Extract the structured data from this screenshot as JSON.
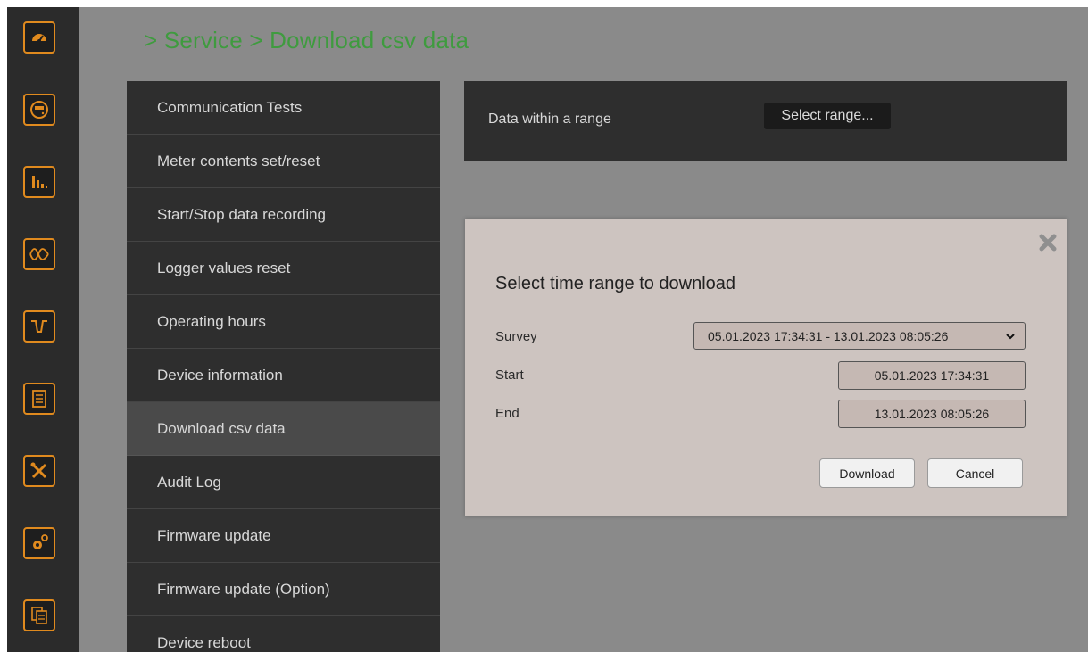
{
  "breadcrumb": "> Service > Download csv data",
  "rail_icons": [
    "gauge-icon",
    "meter-icon",
    "bar-chart-icon",
    "waveform-icon",
    "dip-signal-icon",
    "report-icon",
    "tools-icon",
    "settings-gears-icon",
    "documents-icon"
  ],
  "menu": {
    "items": [
      {
        "label": "Communication Tests"
      },
      {
        "label": "Meter contents set/reset"
      },
      {
        "label": "Start/Stop data recording"
      },
      {
        "label": "Logger values reset"
      },
      {
        "label": "Operating hours"
      },
      {
        "label": "Device information"
      },
      {
        "label": "Download csv data"
      },
      {
        "label": "Audit Log"
      },
      {
        "label": "Firmware update"
      },
      {
        "label": "Firmware update (Option)"
      },
      {
        "label": "Device reboot"
      }
    ],
    "active_index": 6
  },
  "range_panel": {
    "label": "Data within a range",
    "button": "Select range..."
  },
  "dialog": {
    "title": "Select time range to download",
    "survey_label": "Survey",
    "survey_value": "05.01.2023 17:34:31 - 13.01.2023 08:05:26",
    "start_label": "Start",
    "start_value": "05.01.2023 17:34:31",
    "end_label": "End",
    "end_value": "13.01.2023 08:05:26",
    "download_button": "Download",
    "cancel_button": "Cancel"
  },
  "colors": {
    "accent_orange": "#e08a1e",
    "breadcrumb_green": "#3f9b3f",
    "panel_dark": "#2e2e2e",
    "dialog_bg": "#cdc4c0"
  }
}
